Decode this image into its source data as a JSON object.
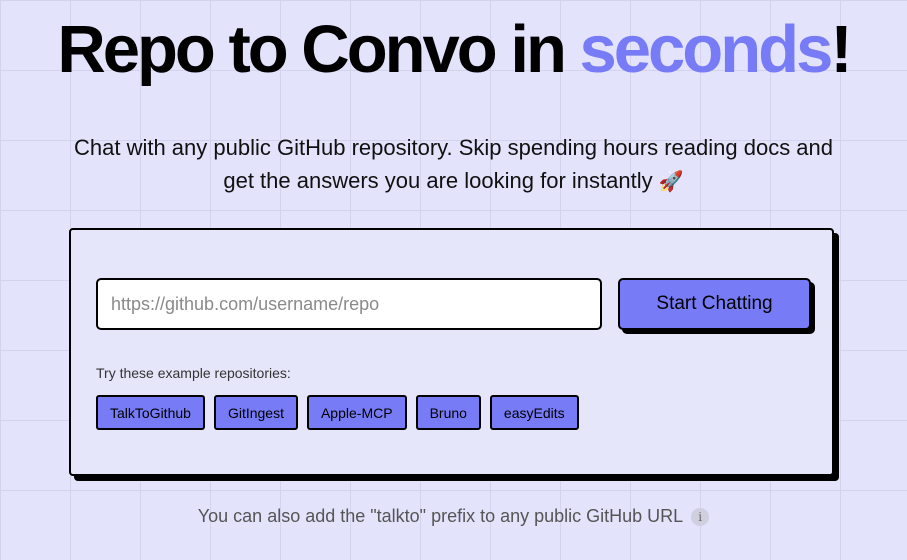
{
  "hero": {
    "title_main": "Repo to Convo in ",
    "title_accent": "seconds",
    "title_end": "!"
  },
  "subtitle": {
    "text": "Chat with any public GitHub repository. Skip spending hours reading docs and get the answers you are looking for instantly ",
    "emoji": "🚀"
  },
  "form": {
    "input_value": "",
    "input_placeholder": "https://github.com/username/repo",
    "submit_label": "Start Chatting"
  },
  "examples": {
    "label": "Try these example repositories:",
    "items": [
      {
        "label": "TalkToGithub"
      },
      {
        "label": "GitIngest"
      },
      {
        "label": "Apple-MCP"
      },
      {
        "label": "Bruno"
      },
      {
        "label": "easyEdits"
      }
    ]
  },
  "footer": {
    "note": "You can also add the \"talkto\" prefix to any public GitHub URL",
    "info_glyph": "i"
  },
  "colors": {
    "background": "#e3e3fc",
    "accent": "#777bf6",
    "card_background": "#e6e6fb"
  }
}
